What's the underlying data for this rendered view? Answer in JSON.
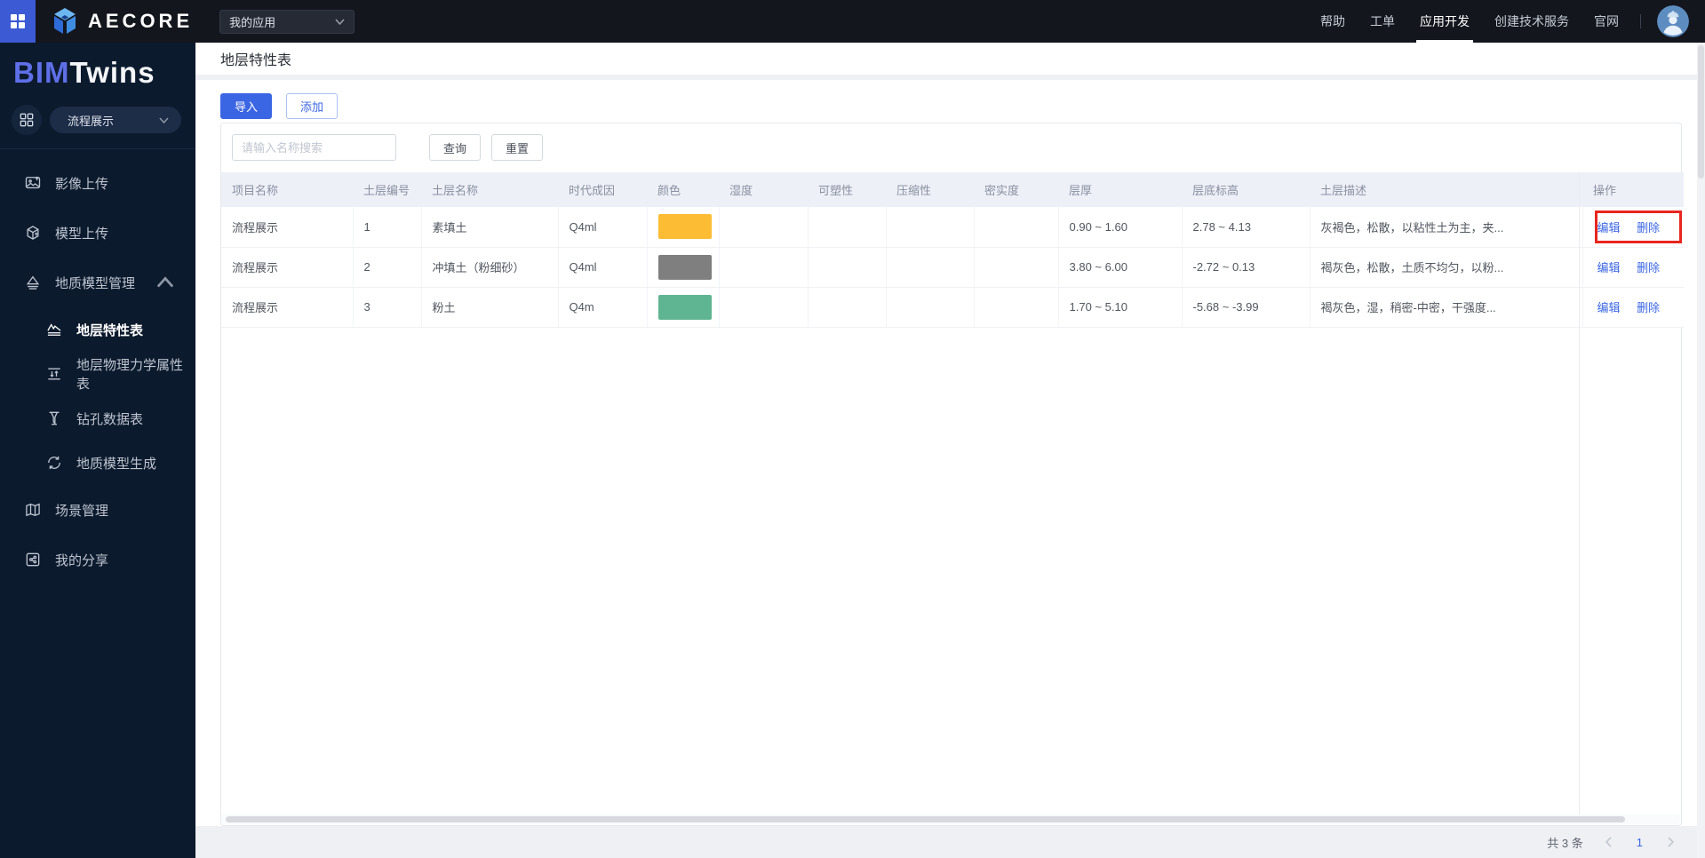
{
  "topbar": {
    "brand": "AECORE",
    "app_select_value": "我的应用",
    "nav": [
      {
        "label": "帮助",
        "active": false
      },
      {
        "label": "工单",
        "active": false
      },
      {
        "label": "应用开发",
        "active": true
      },
      {
        "label": "创建技术服务",
        "active": false
      },
      {
        "label": "官网",
        "active": false
      }
    ]
  },
  "sidebar": {
    "logo_bim": "BIM",
    "logo_twins": "Twins",
    "project_select_value": "流程展示",
    "items": [
      {
        "label": "影像上传",
        "icon": "image-upload-icon"
      },
      {
        "label": "模型上传",
        "icon": "model-upload-icon"
      },
      {
        "label": "地质模型管理",
        "icon": "geology-icon",
        "expanded": true,
        "children": [
          {
            "label": "地层特性表",
            "icon": "strata-table-icon",
            "active": true
          },
          {
            "label": "地层物理力学属性表",
            "icon": "physics-table-icon",
            "active": false
          },
          {
            "label": "钻孔数据表",
            "icon": "borehole-icon",
            "active": false
          },
          {
            "label": "地质模型生成",
            "icon": "model-generate-icon",
            "active": false
          }
        ]
      },
      {
        "label": "场景管理",
        "icon": "scene-icon"
      },
      {
        "label": "我的分享",
        "icon": "share-icon"
      }
    ]
  },
  "main": {
    "page_title": "地层特性表",
    "toolbar": {
      "import_label": "导入",
      "add_label": "添加"
    },
    "search": {
      "placeholder": "请输入名称搜索",
      "value": "",
      "query_label": "查询",
      "reset_label": "重置"
    },
    "table": {
      "columns": [
        "项目名称",
        "土层编号",
        "土层名称",
        "时代成因",
        "颜色",
        "湿度",
        "可塑性",
        "压缩性",
        "密实度",
        "层厚",
        "层底标高",
        "土层描述",
        "操作"
      ],
      "rows": [
        {
          "project": "流程展示",
          "layer_no": "1",
          "layer_name": "素填土",
          "era": "Q4ml",
          "color": "#fcbc33",
          "humidity": "",
          "plasticity": "",
          "compressibility": "",
          "density": "",
          "thickness": "0.90 ~ 1.60",
          "bottom_elevation": "2.78 ~ 4.13",
          "description": "灰褐色，松散，以粘性土为主，夹...",
          "highlighted": true
        },
        {
          "project": "流程展示",
          "layer_no": "2",
          "layer_name": "冲填土（粉细砂）",
          "era": "Q4ml",
          "color": "#7f7f7f",
          "humidity": "",
          "plasticity": "",
          "compressibility": "",
          "density": "",
          "thickness": "3.80 ~ 6.00",
          "bottom_elevation": "-2.72 ~ 0.13",
          "description": "褐灰色，松散，土质不均匀，以粉...",
          "highlighted": false
        },
        {
          "project": "流程展示",
          "layer_no": "3",
          "layer_name": "粉土",
          "era": "Q4m",
          "color": "#5fb592",
          "humidity": "",
          "plasticity": "",
          "compressibility": "",
          "density": "",
          "thickness": "1.70 ~ 5.10",
          "bottom_elevation": "-5.68 ~ -3.99",
          "description": "褐灰色，湿，稍密-中密，干强度...",
          "highlighted": false
        }
      ],
      "actions": {
        "edit_label": "编辑",
        "delete_label": "删除"
      }
    },
    "pagination": {
      "total_text": "共 3 条",
      "current_page": "1"
    }
  },
  "colors": {
    "accent_blue": "#3b66e3",
    "topbar_bg": "#13161d",
    "topbar_tile_blue": "#3d5ad5",
    "sidebar_bg": "#0c1a2d",
    "logo_purple": "#5e6fe8",
    "table_header_bg": "#eef0f8",
    "highlight_red": "#e8261f",
    "swatch_row1": "#fcbc33",
    "swatch_row2": "#7f7f7f",
    "swatch_row3": "#5fb592"
  },
  "icons": {
    "apps-grid-icon": "four-squares",
    "chevron-down-icon": "v",
    "chevron-up-icon": "^",
    "page-prev-icon": "<",
    "page-next-icon": ">",
    "avatar-icon": "worker-with-hardhat"
  }
}
